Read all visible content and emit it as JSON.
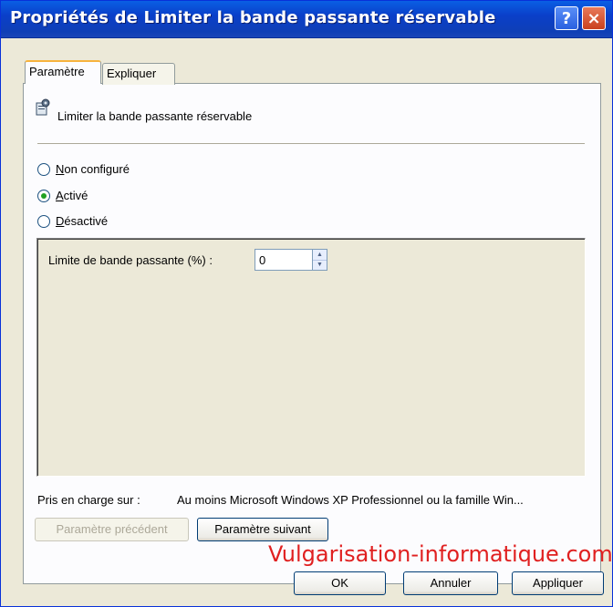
{
  "window": {
    "title": "Propriétés de Limiter la bande passante réservable",
    "help_glyph": "?",
    "close_glyph": "×"
  },
  "tabs": [
    {
      "label": "Paramètre",
      "active": true
    },
    {
      "label": "Expliquer",
      "active": false
    }
  ],
  "policy": {
    "icon": "policy-setting-icon",
    "label": "Limiter la bande passante réservable"
  },
  "radios": [
    {
      "label_first": "N",
      "label_rest": "on configuré",
      "checked": false
    },
    {
      "label_first": "A",
      "label_rest": "ctivé",
      "checked": true
    },
    {
      "label_first": "D",
      "label_rest": "ésactivé",
      "checked": false
    }
  ],
  "bandwidth": {
    "label": "Limite de bande passante (%) :",
    "value": "0"
  },
  "supported": {
    "label": "Pris en charge sur :",
    "value": "Au moins Microsoft Windows XP Professionnel ou la famille Win..."
  },
  "nav_buttons": {
    "prev": "Paramètre précédent",
    "next": "Paramètre suivant"
  },
  "buttons": {
    "ok": "OK",
    "cancel": "Annuler",
    "apply": "Appliquer"
  },
  "watermark": "Vulgarisation-informatique.com",
  "colors": {
    "titlebar": "#0a3fc9",
    "dialog_bg": "#ece9d8",
    "active_tab_accent": "#f7b33d",
    "watermark": "#e02020",
    "radio_dot": "#21a121"
  }
}
